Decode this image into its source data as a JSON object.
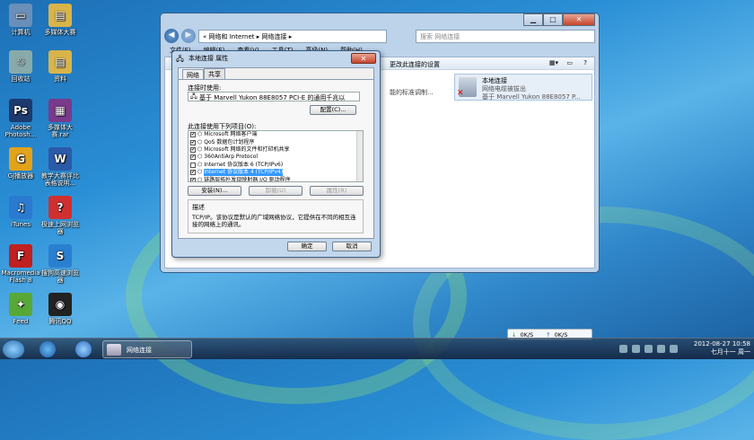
{
  "desktop": {
    "icons": [
      {
        "label": "计算机",
        "glyph": "computer-icon",
        "color": "#6a8fb8"
      },
      {
        "label": "多媒体大赛",
        "glyph": "folder-icon",
        "color": "#d9b44a"
      },
      {
        "label": "回收站",
        "glyph": "recycle-bin-icon",
        "color": "#8aa"
      },
      {
        "label": "资料",
        "glyph": "folder-icon",
        "color": "#d9b44a"
      },
      {
        "label": "Adobe Photosh...",
        "glyph": "Ps",
        "color": "#1c3a6e"
      },
      {
        "label": "多媒体大赛.rar",
        "glyph": "rar-icon",
        "color": "#7a3a8c"
      },
      {
        "label": "GJ播放器",
        "glyph": "G",
        "color": "#e2a21a"
      },
      {
        "label": "教学大赛评比表格说明...",
        "glyph": "doc-icon",
        "color": "#2b5aa8"
      },
      {
        "label": "iTunes",
        "glyph": "♫",
        "color": "#2a7ad0"
      },
      {
        "label": "极速上网浏览器",
        "glyph": "?",
        "color": "#d03030"
      },
      {
        "label": "Macromedia Flash 8",
        "glyph": "F",
        "color": "#c02020"
      },
      {
        "label": "搜狗高速浏览器",
        "glyph": "S",
        "color": "#2a80d0"
      },
      {
        "label": "Feed",
        "glyph": "bird-icon",
        "color": "#58a838"
      },
      {
        "label": "腾讯QQ",
        "glyph": "penguin-icon",
        "color": "#222"
      }
    ]
  },
  "explorer": {
    "address": "« 网络和 Internet ▸ 网络连接 ▸",
    "search_placeholder": "搜索 网络连接",
    "menu": [
      "文件(F)",
      "编辑(E)",
      "查看(V)",
      "工具(T)",
      "高级(N)",
      "帮助(H)"
    ],
    "command": "更改此连接的设置",
    "partial_text": "能的标准调制...",
    "connection": {
      "name": "本地连接",
      "status": "网络电缆被拔出",
      "device": "基于 Marvell Yukon 88E8057 P..."
    }
  },
  "dialog": {
    "title": "本地连接 属性",
    "tabs": [
      "网络",
      "共享"
    ],
    "connect_using_label": "连接时使用:",
    "adapter": "基于 Marvell Yukon 88E8057 PCI-E 的通用千兆以",
    "configure_button": "配置(C)...",
    "items_label": "此连接使用下列项目(O):",
    "items": [
      {
        "text": "Microsoft 网络客户端",
        "checked": true,
        "selected": false
      },
      {
        "text": "QoS 数据包计划程序",
        "checked": true,
        "selected": false
      },
      {
        "text": "Microsoft 网络的文件和打印机共享",
        "checked": true,
        "selected": false
      },
      {
        "text": "360AntiArp Protocol",
        "checked": true,
        "selected": false
      },
      {
        "text": "Internet 协议版本 6 (TCP/IPv6)",
        "checked": false,
        "selected": false
      },
      {
        "text": "Internet 协议版本 4 (TCP/IPv4)",
        "checked": true,
        "selected": true
      },
      {
        "text": "链路层拓扑发现映射器 I/O 驱动程序",
        "checked": true,
        "selected": false
      }
    ],
    "install_button": "安装(N)...",
    "uninstall_button": "卸载(U)",
    "properties_button": "属性(R)",
    "description_label": "描述",
    "description_text": "TCP/IP。该协议是默认的广域网络协议，它提供在不同的相互连接的网络上的通讯。",
    "ok_button": "确定",
    "cancel_button": "取消"
  },
  "taskbar": {
    "active_item": "网络连接",
    "date": "2012-08-27",
    "time": "10:58",
    "weekday": "七月十一 周一",
    "net_down": "0K/S",
    "net_up": "0K/S"
  }
}
